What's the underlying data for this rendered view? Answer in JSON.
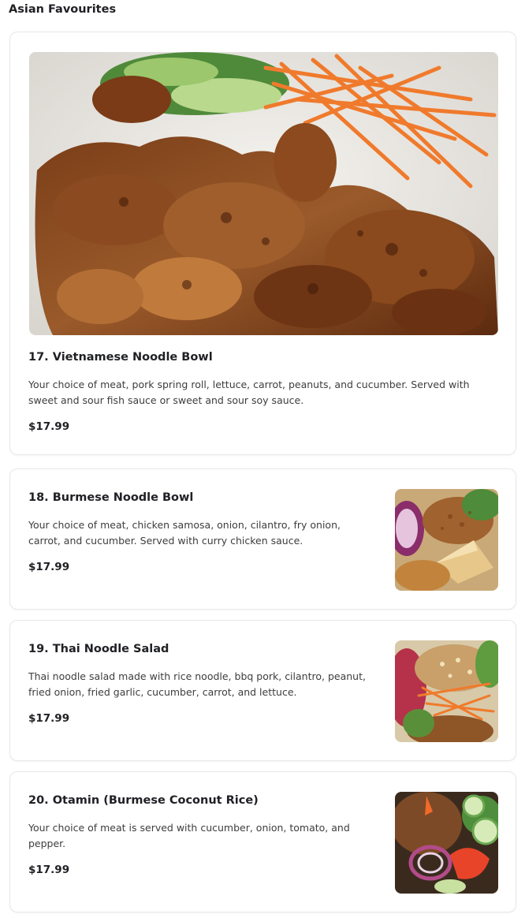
{
  "section": {
    "title": "Asian Favourites"
  },
  "items": [
    {
      "name": "17. Vietnamese Noodle Bowl",
      "description": "Your choice of meat, pork spring roll, lettuce, carrot, peanuts, and cucumber. Served with sweet and sour fish sauce or sweet and sour soy sauce.",
      "price": "$17.99"
    },
    {
      "name": "18. Burmese Noodle Bowl",
      "description": "Your choice of meat, chicken samosa, onion, cilantro, fry onion, carrot, and cucumber. Served with curry chicken sauce.",
      "price": "$17.99"
    },
    {
      "name": "19. Thai Noodle Salad",
      "description": "Thai noodle salad made with rice noodle, bbq pork, cilantro, peanut, fried onion, fried garlic, cucumber, carrot, and lettuce.",
      "price": "$17.99"
    },
    {
      "name": "20. Otamin (Burmese Coconut Rice)",
      "description": "Your choice of meat is served with cucumber, onion, tomato, and pepper.",
      "price": "$17.99"
    }
  ]
}
